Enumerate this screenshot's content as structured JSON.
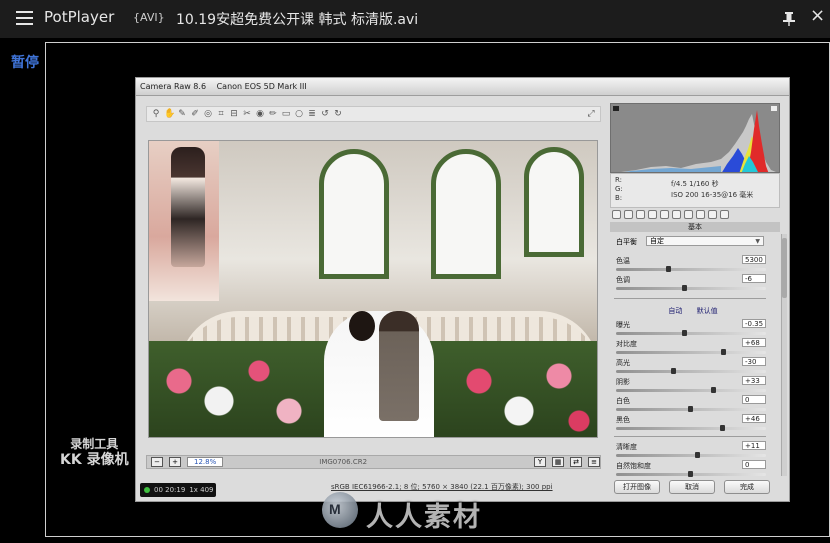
{
  "player": {
    "app_name": "PotPlayer",
    "format_tag": "{AVI}",
    "file_name": "10.19安超免费公开课 韩式 标清版.avi",
    "status": "暂停"
  },
  "watermark": {
    "kk_line1": "录制工具",
    "kk_line2": "KK 录像机",
    "site_text": "人人素材",
    "site_logo": "M"
  },
  "camera_raw": {
    "title": "Camera Raw 8.6",
    "camera": "Canon EOS 5D Mark III",
    "zoom": "12.8%",
    "zoom_mid": "IMG0706.CR2",
    "file_info": "sRGB IEC61966-2.1; 8 位; 5760 × 3840 (22.1 百万像素); 300 ppi",
    "recorder_time": "00 20:19",
    "recorder_size": "1x 409",
    "buttons": {
      "open": "打开图像",
      "cancel": "取消",
      "done": "完成"
    },
    "info": {
      "r": "R:",
      "g": "G:",
      "b": "B:",
      "aperture": "f/4.5  1/160 秒",
      "iso": "ISO 200  16-35@16 毫米"
    },
    "panel_title": "基本",
    "white_balance": {
      "label": "白平衡",
      "value": "自定"
    },
    "auto_labels": {
      "auto": "自动",
      "default": "默认值"
    },
    "controls": [
      {
        "label": "色温",
        "value": "5300",
        "pos": 0.35
      },
      {
        "label": "色调",
        "value": "-6",
        "pos": 0.46
      },
      {
        "label": "曝光",
        "value": "-0.35",
        "pos": 0.46
      },
      {
        "label": "对比度",
        "value": "+68",
        "pos": 0.73
      },
      {
        "label": "高光",
        "value": "-30",
        "pos": 0.38
      },
      {
        "label": "阴影",
        "value": "+33",
        "pos": 0.66
      },
      {
        "label": "白色",
        "value": "0",
        "pos": 0.5
      },
      {
        "label": "黑色",
        "value": "+46",
        "pos": 0.72
      },
      {
        "label": "清晰度",
        "value": "+11",
        "pos": 0.55
      },
      {
        "label": "自然饱和度",
        "value": "0",
        "pos": 0.5
      }
    ]
  }
}
